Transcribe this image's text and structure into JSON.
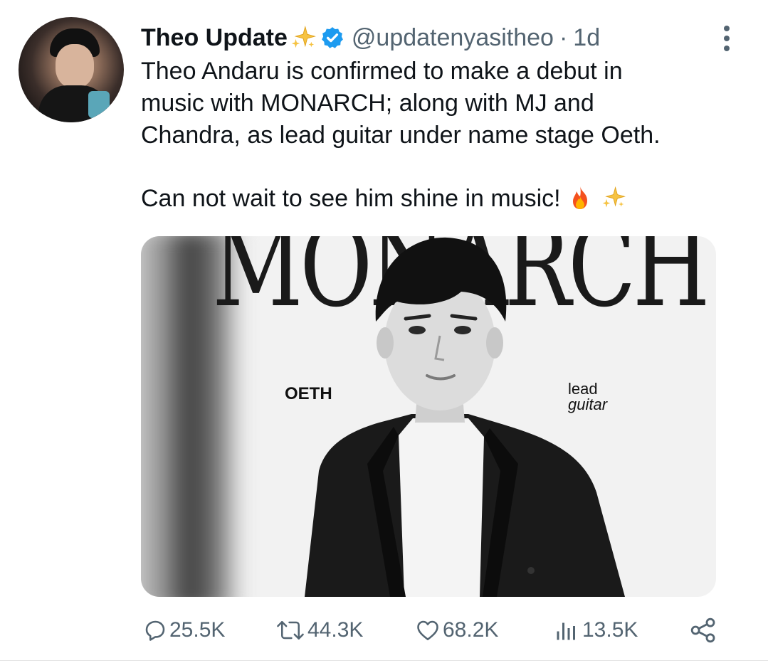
{
  "tweet": {
    "display_name": "Theo Update",
    "handle": "@updatenyasitheo",
    "separator": "·",
    "time": "1d",
    "text_line1": "Theo Andaru is confirmed to make a debut in",
    "text_line2": "music with MONARCH; along with MJ and",
    "text_line3": "Chandra, as lead guitar under name stage Oeth.",
    "text_line4": "Can not wait to see him shine in music!",
    "emoji": [
      "fire-emoji",
      "sparkles-emoji"
    ]
  },
  "media": {
    "title_text": "MONARCH",
    "label_left": "OETH",
    "label_right_1": "lead",
    "label_right_2": "guitar"
  },
  "actions": {
    "reply_count": "25.5K",
    "retweet_count": "44.3K",
    "like_count": "68.2K",
    "views_count": "13.5K"
  },
  "icons": {
    "verified": "verified-badge-icon",
    "more": "more-vertical-icon",
    "reply": "reply-icon",
    "retweet": "retweet-icon",
    "like": "heart-icon",
    "views": "views-chart-icon",
    "share": "share-icon"
  },
  "colors": {
    "verified_blue": "#1d9bf0",
    "text_primary": "#0f1419",
    "text_secondary": "#536471"
  }
}
